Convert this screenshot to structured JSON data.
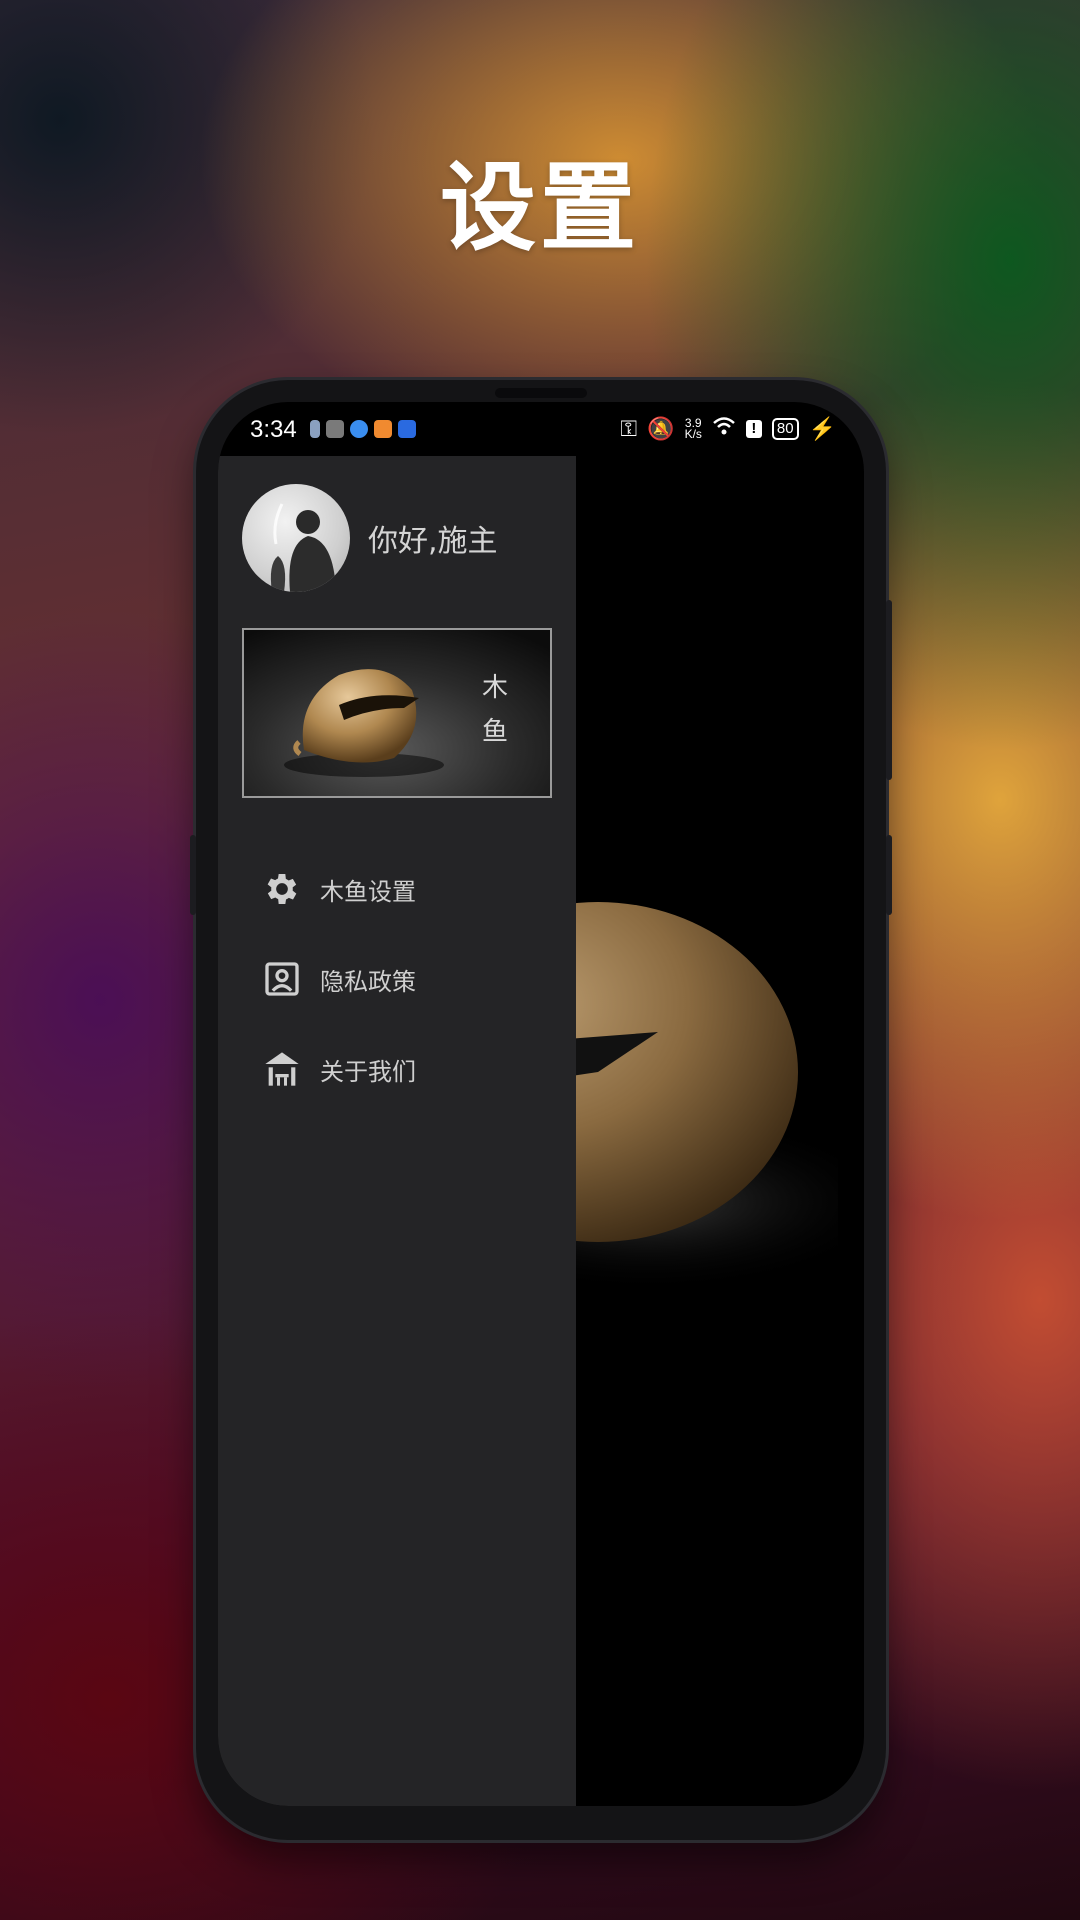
{
  "page": {
    "title": "设置"
  },
  "status_bar": {
    "time": "3:34",
    "net_speed_value": "3.9",
    "net_speed_unit": "K/s",
    "battery": "80"
  },
  "drawer": {
    "greeting": "你好,施主",
    "banner_seal": "木鱼",
    "menu": [
      {
        "label": "木鱼设置",
        "icon": "gear-icon"
      },
      {
        "label": "隐私政策",
        "icon": "portrait-icon"
      },
      {
        "label": "关于我们",
        "icon": "pavilion-icon"
      }
    ]
  }
}
